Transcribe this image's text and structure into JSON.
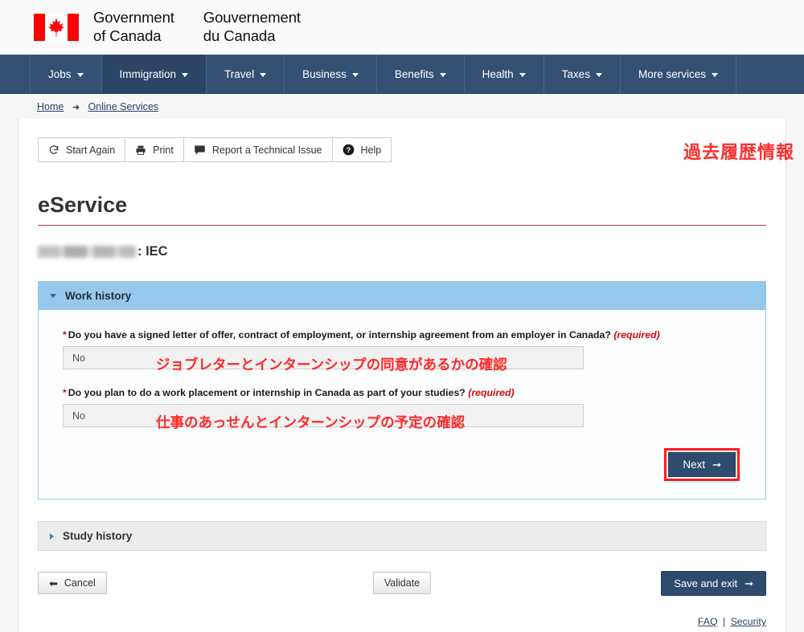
{
  "header": {
    "flag_alt": "canada-flag",
    "wordmark_en_line1": "Government",
    "wordmark_en_line2": "of Canada",
    "wordmark_fr_line1": "Gouvernement",
    "wordmark_fr_line2": "du Canada"
  },
  "nav": {
    "items": [
      {
        "label": "Jobs",
        "active": false
      },
      {
        "label": "Immigration",
        "active": true
      },
      {
        "label": "Travel",
        "active": false
      },
      {
        "label": "Business",
        "active": false
      },
      {
        "label": "Benefits",
        "active": false
      },
      {
        "label": "Health",
        "active": false
      },
      {
        "label": "Taxes",
        "active": false
      },
      {
        "label": "More services",
        "active": false
      }
    ]
  },
  "breadcrumb": {
    "home": "Home",
    "separator": "➜",
    "current": "Online Services"
  },
  "toolbar": {
    "start_again": "Start Again",
    "print": "Print",
    "report_issue": "Report a Technical Issue",
    "help": "Help"
  },
  "main": {
    "page_title": "eService",
    "subject_suffix": ": IEC",
    "subject_redacted": true
  },
  "annotations": {
    "top_right": "過去履歴情報",
    "field1": "ジョブレターとインターンシップの同意があるかの確認",
    "field2": "仕事のあっせんとインターンシップの予定の確認"
  },
  "work_history": {
    "title": "Work history",
    "expanded": true,
    "fields": [
      {
        "label": "Do you have a signed letter of offer, contract of employment, or internship agreement from an employer in Canada?",
        "required_tag": "(required)",
        "value": "No"
      },
      {
        "label": "Do you plan to do a work placement or internship in Canada as part of your studies?",
        "required_tag": "(required)",
        "value": "No"
      }
    ],
    "next_label": "Next"
  },
  "study_history": {
    "title": "Study history",
    "expanded": false
  },
  "footer_buttons": {
    "cancel": "Cancel",
    "validate": "Validate",
    "save_and_exit": "Save and exit"
  },
  "footer_links": {
    "faq": "FAQ",
    "separator": "|",
    "security": "Security"
  },
  "colors": {
    "nav_blue": "#335075",
    "nav_active": "#2b4566",
    "panel_header_blue": "#95c8ea",
    "primary_button": "#2e4b6e",
    "accent_red": "#af3c43",
    "required_red": "#d3080c",
    "annotation_red": "#ff2a2a",
    "highlight_box_red": "#ff1a1a",
    "link_blue": "#284162"
  }
}
